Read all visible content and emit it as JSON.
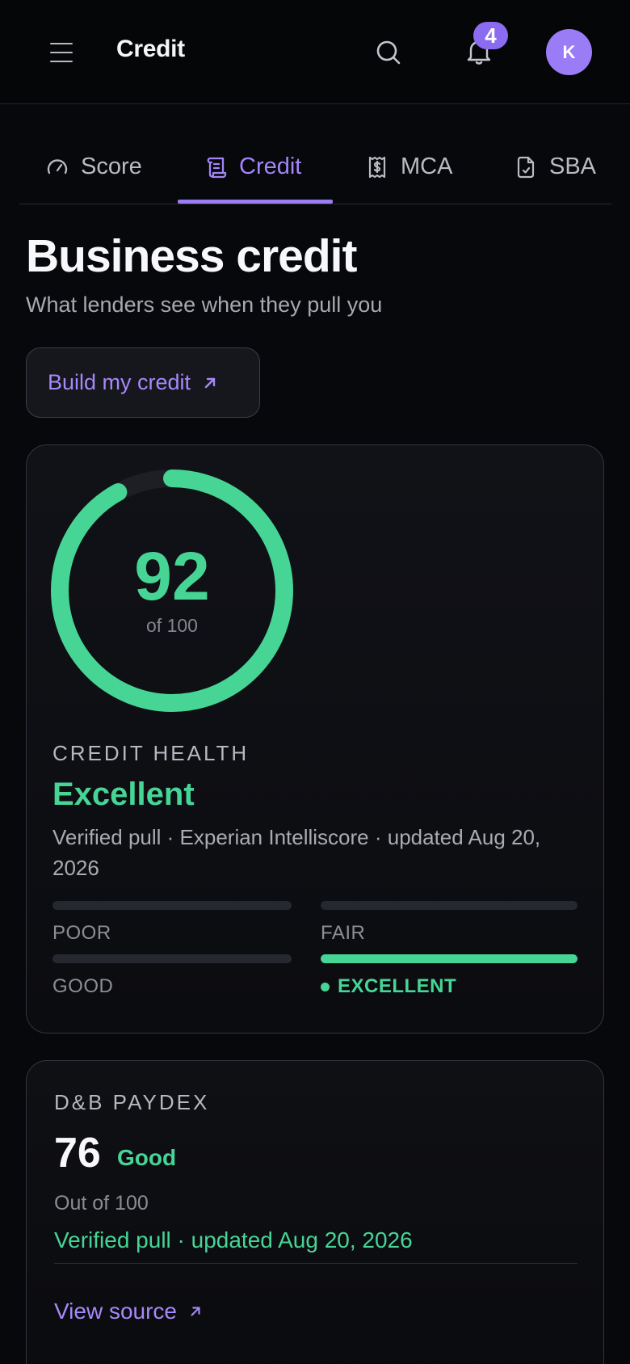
{
  "header": {
    "title": "Credit",
    "notification_count": "4",
    "avatar_initial": "K"
  },
  "tabs": [
    {
      "label": "Score",
      "icon": "gauge-icon",
      "active": false
    },
    {
      "label": "Credit",
      "icon": "receipt-icon",
      "active": true
    },
    {
      "label": "MCA",
      "icon": "dollar-receipt-icon",
      "active": false
    },
    {
      "label": "SBA",
      "icon": "document-check-icon",
      "active": false
    }
  ],
  "page": {
    "title": "Business credit",
    "subtitle": "What lenders see when they pull you",
    "build_button_label": "Build my credit"
  },
  "score_card": {
    "score": "92",
    "score_value": 92,
    "out_of": "of 100",
    "health_label": "CREDIT HEALTH",
    "health_value": "Excellent",
    "description": "Verified pull · Experian Intelliscore · updated Aug 20, 2026",
    "tiers": [
      {
        "label": "POOR",
        "active": false
      },
      {
        "label": "FAIR",
        "active": false
      },
      {
        "label": "GOOD",
        "active": false
      },
      {
        "label": "EXCELLENT",
        "active": true
      }
    ]
  },
  "paydex_card": {
    "label": "D&B PAYDEX",
    "score": "76",
    "rating": "Good",
    "out_of": "Out of 100",
    "meta": "Verified pull · updated Aug 20, 2026",
    "link_label": "View source"
  },
  "colors": {
    "accent": "#9a7cf4",
    "success": "#46d594",
    "background": "#07080b"
  }
}
